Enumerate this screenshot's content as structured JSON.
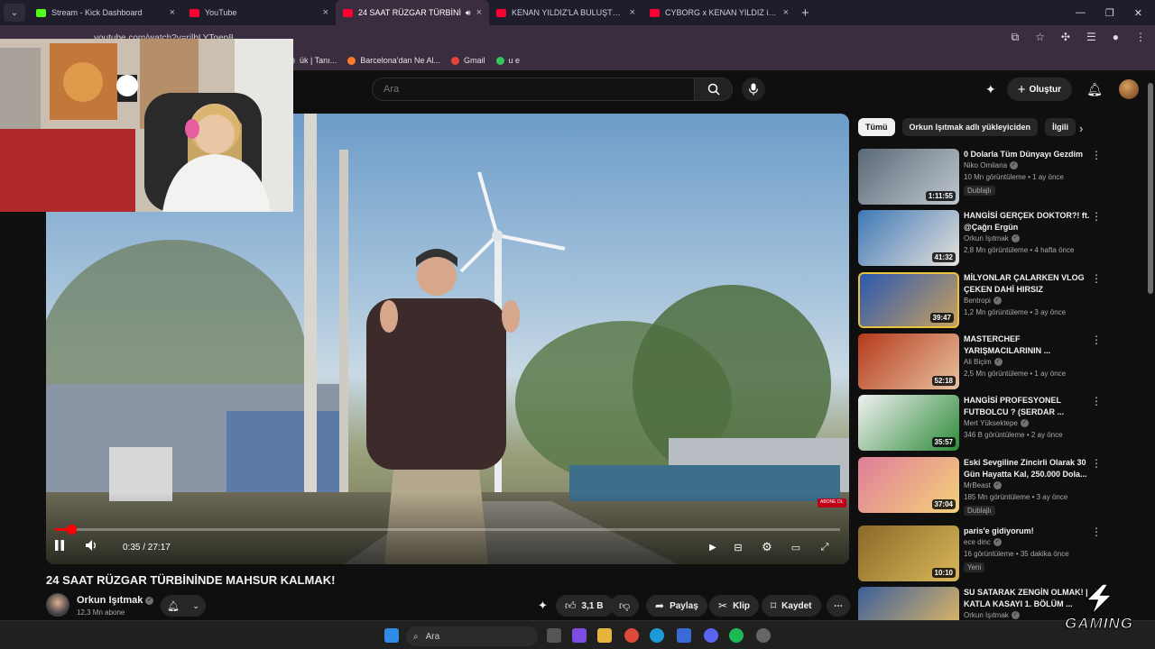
{
  "browser": {
    "tabs": [
      {
        "title": "Stream - Kick Dashboard",
        "color": "#53fc18"
      },
      {
        "title": "YouTube",
        "color": "#ff0033"
      },
      {
        "title": "24 SAAT RÜZGAR TÜRBİNİ",
        "color": "#ff0033",
        "active": true
      },
      {
        "title": "KENAN YILDIZ'LA BULUŞTUM -",
        "color": "#ff0033"
      },
      {
        "title": "CYBORG x KENAN YILDIZ in Tu",
        "color": "#ff0033"
      }
    ],
    "url": "youtube.com/watch?v=rjlbLYToep8",
    "bookmarks": [
      {
        "label": "ük | Tanı...",
        "color": "#8a8a8a"
      },
      {
        "label": "Barcelona'dan Ne Al...",
        "color": "#ff7a2a"
      },
      {
        "label": "Gmail",
        "color": "#ea4335"
      },
      {
        "label": "u e",
        "color": "#34c759"
      }
    ]
  },
  "header": {
    "search_placeholder": "Ara",
    "create_label": "Oluştur"
  },
  "player": {
    "current_time": "0:35",
    "duration": "27:17",
    "time_display": "0:35 / 27:17",
    "progress_fraction": 0.021,
    "subscribe_badge": "ABONE OL"
  },
  "video": {
    "title": "24 SAAT RÜZGAR TÜRBİNİNDE MAHSUR KALMAK!",
    "channel": "Orkun Işıtmak",
    "subscribers": "12,3 Mn abone",
    "likes": "3,1 B",
    "actions": {
      "share": "Paylaş",
      "clip": "Klip",
      "save": "Kaydet"
    }
  },
  "sidebar": {
    "chips": [
      "Tümü",
      "Orkun Işıtmak adlı yükleyiciden",
      "İlgili"
    ],
    "items": [
      {
        "title": "0 Dolarla Tüm Dünyayı Gezdim",
        "channel": "Niko Omilana",
        "meta": "10 Mn görüntüleme • 1 ay önce",
        "badge": "Dublajlı",
        "duration": "1:11:55",
        "colors": [
          "#5b6a77",
          "#bfc7cf"
        ]
      },
      {
        "title": "HANGİSİ GERÇEK DOKTOR?! ft. @Çağrı Ergün",
        "channel": "Orkun Işıtmak",
        "meta": "2,8 Mn görüntüleme • 4 hafta önce",
        "badge": "",
        "duration": "41:32",
        "colors": [
          "#3e78b8",
          "#e7e2da"
        ]
      },
      {
        "title": "MİLYONLAR ÇALARKEN VLOG ÇEKEN DAHİ HIRSIZ",
        "channel": "Bentropi",
        "meta": "1,2 Mn görüntüleme • 3 ay önce",
        "badge": "",
        "duration": "39:47",
        "colors": [
          "#2a58b0",
          "#c8a060"
        ]
      },
      {
        "title": "MASTERCHEF YARIŞMACILARININ ...",
        "channel": "Ali Biçim",
        "meta": "2,5 Mn görüntüleme • 1 ay önce",
        "badge": "",
        "duration": "52:18",
        "colors": [
          "#b53a1c",
          "#e8c2a0"
        ]
      },
      {
        "title": "HANGİSİ PROFESYONEL FUTBOLCU ?  (SERDAR ...",
        "channel": "Mert Yüksektepe",
        "meta": "346 B görüntüleme • 2 ay önce",
        "badge": "",
        "duration": "35:57",
        "colors": [
          "#f0f0f0",
          "#2e8b3a"
        ]
      },
      {
        "title": "Eski Sevgiline Zincirli Olarak 30 Gün Hayatta Kal, 250.000 Dola...",
        "channel": "MrBeast",
        "meta": "185 Mn görüntüleme • 3 ay önce",
        "badge": "Dublajlı",
        "duration": "37:04",
        "colors": [
          "#e07d9a",
          "#f3d27a"
        ]
      },
      {
        "title": "paris'e gidiyorum!",
        "channel": "ece dinc",
        "meta": "16 görüntüleme • 35 dakika önce",
        "badge": "Yeni",
        "duration": "10:10",
        "colors": [
          "#8a6a28",
          "#d9b85a"
        ]
      },
      {
        "title": "SU SATARAK ZENGİN OLMAK! | KATLA KASAYI 1. BÖLÜM ...",
        "channel": "Orkun Işıtmak",
        "meta": "",
        "badge": "",
        "duration": "",
        "colors": [
          "#3b5f9c",
          "#f0c060"
        ]
      }
    ]
  },
  "taskbar": {
    "search_label": "Ara"
  },
  "overlay": {
    "logo_text": "GAMING"
  }
}
